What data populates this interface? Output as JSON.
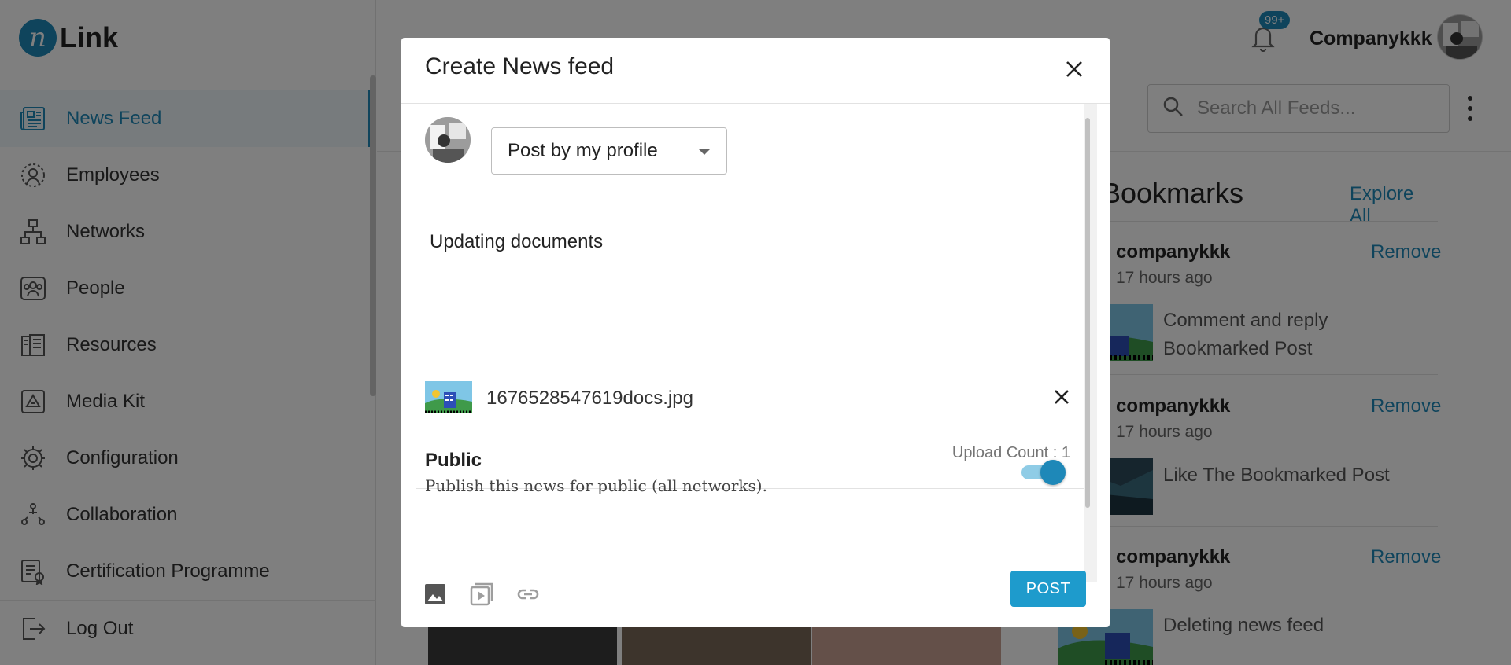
{
  "app": {
    "logo_letter": "n",
    "logo_text": "Link"
  },
  "sidebar": {
    "items": [
      {
        "label": "News Feed",
        "icon": "newspaper-icon",
        "active": true
      },
      {
        "label": "Employees",
        "icon": "employees-icon"
      },
      {
        "label": "Networks",
        "icon": "network-icon"
      },
      {
        "label": "People",
        "icon": "people-icon"
      },
      {
        "label": "Resources",
        "icon": "book-icon"
      },
      {
        "label": "Media Kit",
        "icon": "media-kit-icon"
      },
      {
        "label": "Configuration",
        "icon": "gear-icon"
      },
      {
        "label": "Collaboration",
        "icon": "collaboration-icon"
      },
      {
        "label": "Certification Programme",
        "icon": "certificate-icon"
      }
    ],
    "logout_label": "Log Out"
  },
  "header": {
    "notification_count": "99+",
    "username": "Companykkk"
  },
  "search": {
    "placeholder": "Search All Feeds..."
  },
  "bookmarks": {
    "title": "Bookmarks",
    "explore_label": "Explore All",
    "items": [
      {
        "user": "companykkk",
        "time": "17 hours ago",
        "text": "Comment and reply Bookmarked Post",
        "remove_label": "Remove"
      },
      {
        "user": "companykkk",
        "time": "17 hours ago",
        "text": "Like The Bookmarked Post",
        "remove_label": "Remove"
      },
      {
        "user": "companykkk",
        "time": "17 hours ago",
        "text": "Deleting news feed",
        "remove_label": "Remove"
      }
    ]
  },
  "modal": {
    "title": "Create News feed",
    "post_as": "Post by my profile",
    "post_text": "Updating documents",
    "attachment": {
      "filename": "1676528547619docs.jpg"
    },
    "upload_count": "Upload Count : 1",
    "public": {
      "title": "Public",
      "description": "Publish this news for public (all networks).",
      "enabled": true
    },
    "post_button": "POST"
  },
  "colors": {
    "accent": "#1e88b8",
    "button": "#1e9bcc",
    "overlay": "rgba(0,0,0,0.5)"
  }
}
